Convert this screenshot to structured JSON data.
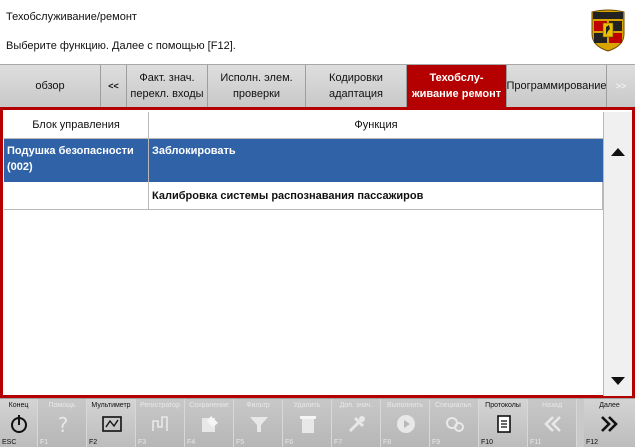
{
  "header": {
    "title": "Техобслуживание/ремонт",
    "instruction": "Выберите функцию. Далее с помощью [F12]."
  },
  "tabs": [
    {
      "label": "обзор",
      "state": "normal"
    },
    {
      "label": "<<",
      "state": "normal"
    },
    {
      "label": "Факт. знач.\nперекл. входы",
      "state": "normal"
    },
    {
      "label": "Исполн. элем.\nпроверки",
      "state": "normal"
    },
    {
      "label": "Кодировки\nадаптация",
      "state": "normal"
    },
    {
      "label": "Техобслу-\nживание ремонт",
      "state": "active"
    },
    {
      "label": "Программирование",
      "state": "normal"
    },
    {
      "label": ">>",
      "state": "disabled"
    }
  ],
  "table": {
    "columns": [
      "Блок управления",
      "Функция"
    ],
    "rows": [
      {
        "control_unit": "Подушка безопасности (002)",
        "function": "Заблокировать",
        "selected": true
      },
      {
        "control_unit": "",
        "function": "Калибровка системы распознавания пассажиров",
        "selected": false
      }
    ]
  },
  "footer": {
    "keys": [
      {
        "label": "Конец",
        "code": "ESC",
        "icon": "power-icon",
        "enabled": true
      },
      {
        "label": "Помощь",
        "code": "F1",
        "icon": "help-icon",
        "enabled": false
      },
      {
        "label": "Мультиметр",
        "code": "F2",
        "icon": "multimeter-icon",
        "enabled": true
      },
      {
        "label": "Регистратор",
        "code": "F3",
        "icon": "recorder-icon",
        "enabled": false
      },
      {
        "label": "Сохранение",
        "code": "F4",
        "icon": "save-icon",
        "enabled": false
      },
      {
        "label": "Фильтр",
        "code": "F5",
        "icon": "filter-icon",
        "enabled": false
      },
      {
        "label": "Удалить",
        "code": "F6",
        "icon": "delete-icon",
        "enabled": false
      },
      {
        "label": "Доп. знач.",
        "code": "F7",
        "icon": "tools-icon",
        "enabled": false
      },
      {
        "label": "Выполнить",
        "code": "F8",
        "icon": "play-icon",
        "enabled": false
      },
      {
        "label": "Специальн.",
        "code": "F9",
        "icon": "special-icon",
        "enabled": false
      },
      {
        "label": "Протоколы",
        "code": "F10",
        "icon": "protocol-icon",
        "enabled": true
      },
      {
        "label": "Назад",
        "code": "F11",
        "icon": "back-icon",
        "enabled": false
      },
      {
        "label": "Далее",
        "code": "F12",
        "icon": "next-icon",
        "enabled": true
      }
    ]
  },
  "colors": {
    "accent_red": "#b40000",
    "selection_blue": "#2f62a6"
  }
}
